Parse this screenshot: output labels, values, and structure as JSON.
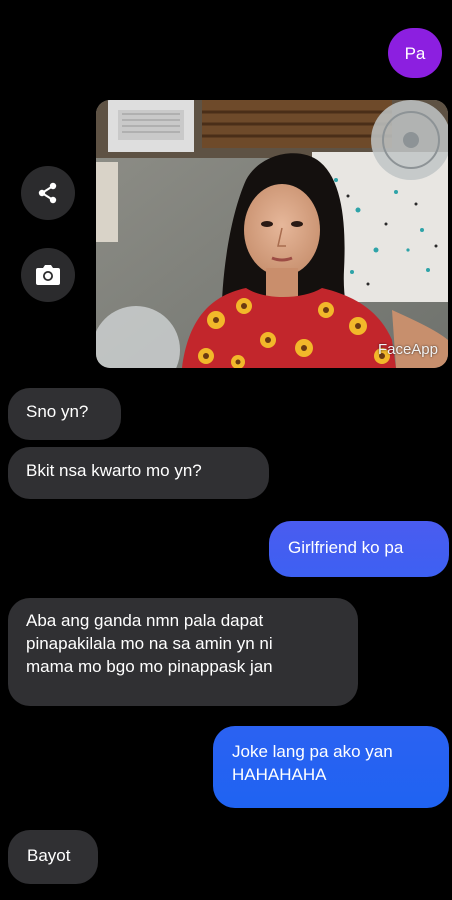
{
  "thread": {
    "sent_top": "Pa",
    "photo_watermark": "FaceApp",
    "messages": [
      {
        "dir": "in",
        "text": "Sno yn?"
      },
      {
        "dir": "in",
        "text": "Bkit nsa kwarto  mo yn?"
      },
      {
        "dir": "out",
        "text": "Girlfriend ko pa"
      },
      {
        "dir": "in",
        "text": "Aba ang ganda nmn pala dapat\npinapakilala mo na sa amin yn ni\nmama mo bgo mo pinappask jan"
      },
      {
        "dir": "out",
        "text": "Joke lang pa ako yan\nHAHAHAHA"
      },
      {
        "dir": "in",
        "text": "Bayot"
      }
    ]
  },
  "actions": {
    "share_icon": "share-icon",
    "camera_icon": "camera-icon"
  },
  "colors": {
    "background": "#000000",
    "incoming_bubble": "#303033",
    "outgoing_gradient_top": "#4a5cf0",
    "outgoing_gradient_bottom": "#1f63f2",
    "pa_bubble": "#8c1fe0"
  }
}
